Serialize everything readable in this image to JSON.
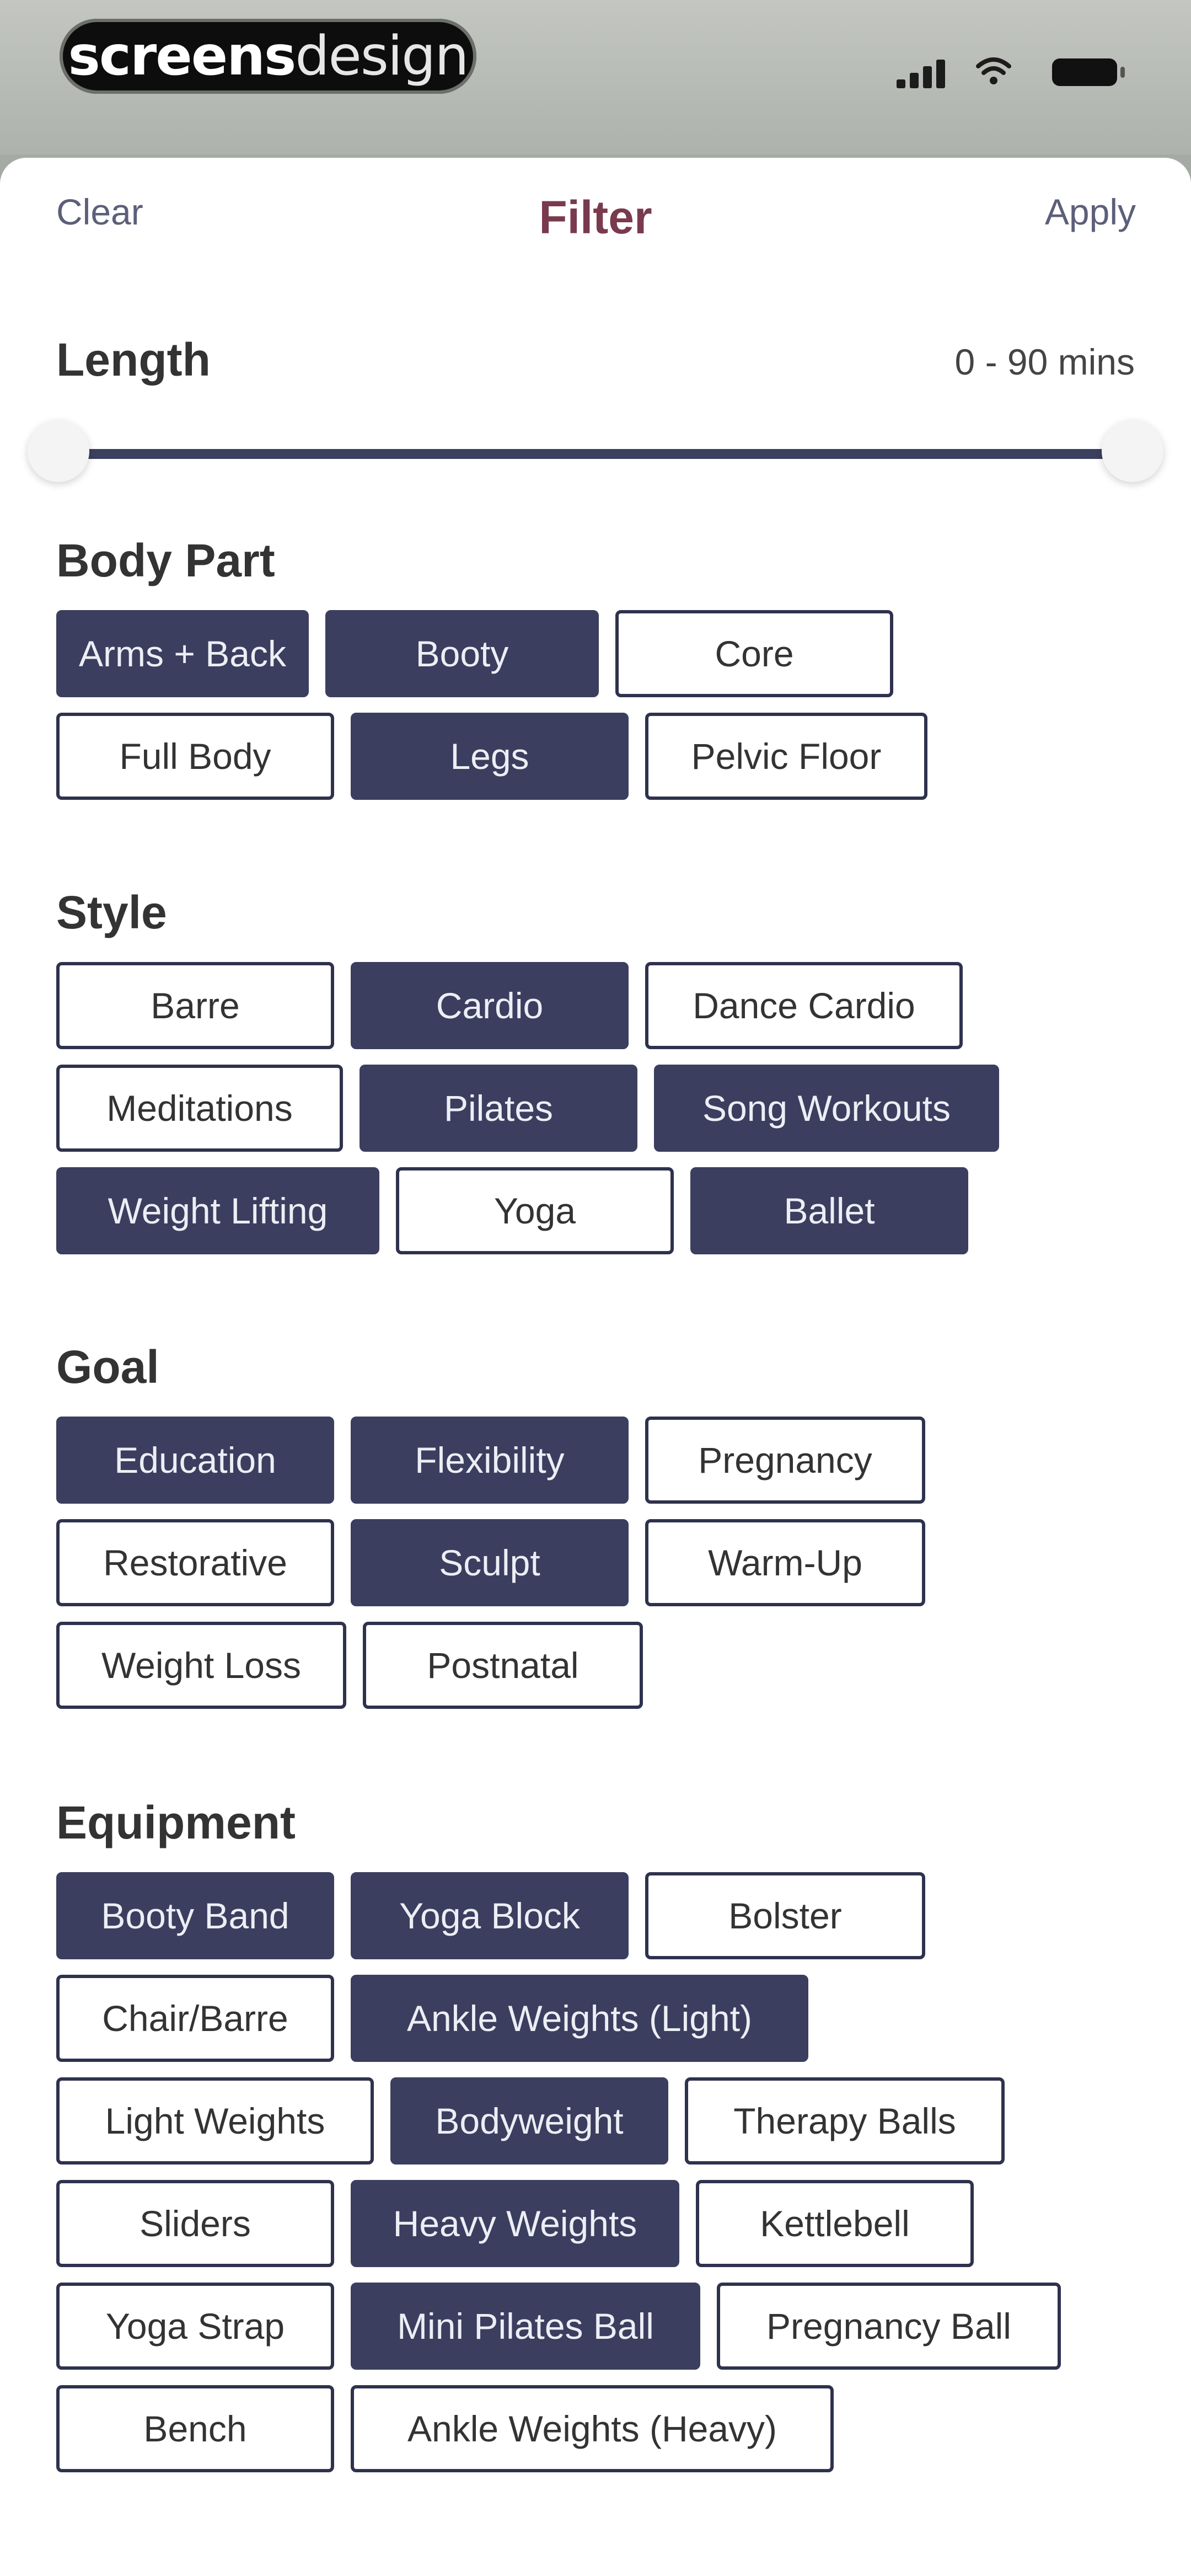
{
  "status_bar": {
    "logo": {
      "bold": "screens",
      "light": "design"
    },
    "signal_icon": "cellular-signal-icon",
    "wifi_icon": "wifi-icon",
    "battery_icon": "battery-icon"
  },
  "nav": {
    "left": "Clear",
    "title": "Filter",
    "right": "Apply"
  },
  "length": {
    "title": "Length",
    "value": "0 - 90 mins",
    "range": {
      "min": 0,
      "max": 90,
      "selected_min": 0,
      "selected_max": 90,
      "unit": "mins"
    }
  },
  "sections": {
    "body_part": {
      "title": "Body Part",
      "rows": [
        [
          {
            "label": "Arms + Back",
            "selected": true
          },
          {
            "label": "Booty",
            "selected": true
          },
          {
            "label": "Core",
            "selected": false
          }
        ],
        [
          {
            "label": "Full Body",
            "selected": false
          },
          {
            "label": "Legs",
            "selected": true
          },
          {
            "label": "Pelvic Floor",
            "selected": false
          }
        ]
      ]
    },
    "style": {
      "title": "Style",
      "rows": [
        [
          {
            "label": "Barre",
            "selected": false
          },
          {
            "label": "Cardio",
            "selected": true
          },
          {
            "label": "Dance Cardio",
            "selected": false
          }
        ],
        [
          {
            "label": "Meditations",
            "selected": false
          },
          {
            "label": "Pilates",
            "selected": true
          },
          {
            "label": "Song Workouts",
            "selected": true
          }
        ],
        [
          {
            "label": "Weight Lifting",
            "selected": true
          },
          {
            "label": "Yoga",
            "selected": false
          },
          {
            "label": "Ballet",
            "selected": true
          }
        ]
      ]
    },
    "goal": {
      "title": "Goal",
      "rows": [
        [
          {
            "label": "Education",
            "selected": true
          },
          {
            "label": "Flexibility",
            "selected": true
          },
          {
            "label": "Pregnancy",
            "selected": false
          }
        ],
        [
          {
            "label": "Restorative",
            "selected": false
          },
          {
            "label": "Sculpt",
            "selected": true
          },
          {
            "label": "Warm-Up",
            "selected": false
          }
        ],
        [
          {
            "label": "Weight Loss",
            "selected": false
          },
          {
            "label": "Postnatal",
            "selected": false
          }
        ]
      ]
    },
    "equipment": {
      "title": "Equipment",
      "rows": [
        [
          {
            "label": "Booty Band",
            "selected": true
          },
          {
            "label": "Yoga Block",
            "selected": true
          },
          {
            "label": "Bolster",
            "selected": false
          }
        ],
        [
          {
            "label": "Chair/Barre",
            "selected": false
          },
          {
            "label": "Ankle Weights (Light)",
            "selected": true
          }
        ],
        [
          {
            "label": "Light Weights",
            "selected": false
          },
          {
            "label": "Bodyweight",
            "selected": true
          },
          {
            "label": "Therapy Balls",
            "selected": false
          }
        ],
        [
          {
            "label": "Sliders",
            "selected": false
          },
          {
            "label": "Heavy Weights",
            "selected": true
          },
          {
            "label": "Kettlebell",
            "selected": false
          }
        ],
        [
          {
            "label": "Yoga Strap",
            "selected": false
          },
          {
            "label": "Mini Pilates Ball",
            "selected": true
          },
          {
            "label": "Pregnancy Ball",
            "selected": false
          }
        ],
        [
          {
            "label": "Bench",
            "selected": false
          },
          {
            "label": "Ankle Weights (Heavy)",
            "selected": false
          }
        ]
      ]
    }
  }
}
